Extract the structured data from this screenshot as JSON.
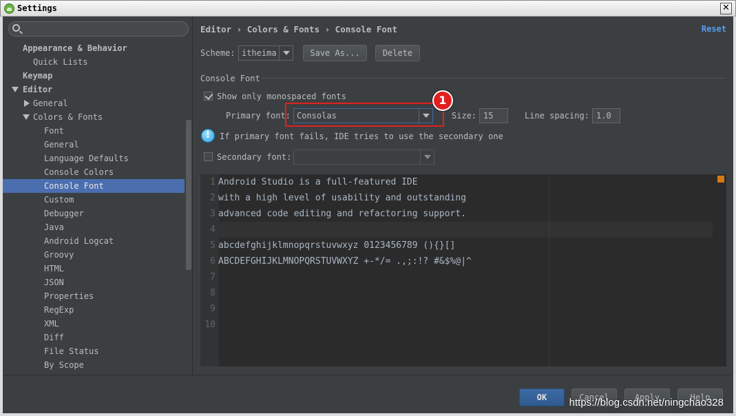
{
  "window": {
    "title": "Settings",
    "close_glyph": "✕"
  },
  "sidebar": {
    "search": {
      "placeholder": ""
    },
    "items": [
      {
        "label": "Appearance & Behavior",
        "bold": true
      },
      {
        "label": "Quick Lists"
      },
      {
        "label": "Keymap",
        "bold": true
      },
      {
        "label": "Editor",
        "bold": true,
        "expanded": true
      },
      {
        "label": "General",
        "collapsed": true
      },
      {
        "label": "Colors & Fonts",
        "expanded": true
      },
      {
        "label": "Font"
      },
      {
        "label": "General"
      },
      {
        "label": "Language Defaults"
      },
      {
        "label": "Console Colors"
      },
      {
        "label": "Console Font",
        "selected": true
      },
      {
        "label": "Custom"
      },
      {
        "label": "Debugger"
      },
      {
        "label": "Java"
      },
      {
        "label": "Android Logcat"
      },
      {
        "label": "Groovy"
      },
      {
        "label": "HTML"
      },
      {
        "label": "JSON"
      },
      {
        "label": "Properties"
      },
      {
        "label": "RegExp"
      },
      {
        "label": "XML"
      },
      {
        "label": "Diff"
      },
      {
        "label": "File Status"
      },
      {
        "label": "By Scope"
      }
    ]
  },
  "header": {
    "breadcrumb": "Editor › Colors & Fonts › Console Font",
    "reset": "Reset"
  },
  "scheme": {
    "label": "Scheme:",
    "value": "itheima",
    "save_as": "Save As...",
    "delete": "Delete"
  },
  "console_font": {
    "section_title": "Console Font",
    "show_mono_label": "Show only monospaced fonts",
    "show_mono_checked": true,
    "primary_label": "Primary font:",
    "primary_value": "Consolas",
    "size_label": "Size:",
    "size_value": "15",
    "spacing_label": "Line spacing:",
    "spacing_value": "1.0",
    "info_text": "If primary font fails, IDE tries to use the secondary one",
    "secondary_label": "Secondary font:",
    "secondary_checked": false,
    "secondary_value": ""
  },
  "annotation": {
    "badge": "1",
    "color": "#e02020"
  },
  "preview": {
    "lines": [
      {
        "num": "1",
        "text": "Android Studio is a full-featured IDE"
      },
      {
        "num": "2",
        "text": "with a high level of usability and outstanding"
      },
      {
        "num": "3",
        "text": "advanced code editing and refactoring support."
      },
      {
        "num": "4",
        "text": ""
      },
      {
        "num": "5",
        "text": "abcdefghijklmnopqrstuvwxyz 0123456789 (){}[]"
      },
      {
        "num": "6",
        "text": "ABCDEFGHIJKLMNOPQRSTUVWXYZ +-*/= .,;:!? #&$%@|^"
      },
      {
        "num": "7",
        "text": ""
      },
      {
        "num": "8",
        "text": ""
      },
      {
        "num": "9",
        "text": ""
      },
      {
        "num": "10",
        "text": ""
      }
    ]
  },
  "footer": {
    "ok": "OK",
    "cancel": "Cancel",
    "apply": "Apply",
    "help": "Help",
    "watermark": "https://blog.csdn.net/ningchao328"
  },
  "colors": {
    "selection": "#4b6eaf",
    "link": "#589df6",
    "background": "#3c3f41",
    "editor_bg": "#2b2b2b"
  }
}
